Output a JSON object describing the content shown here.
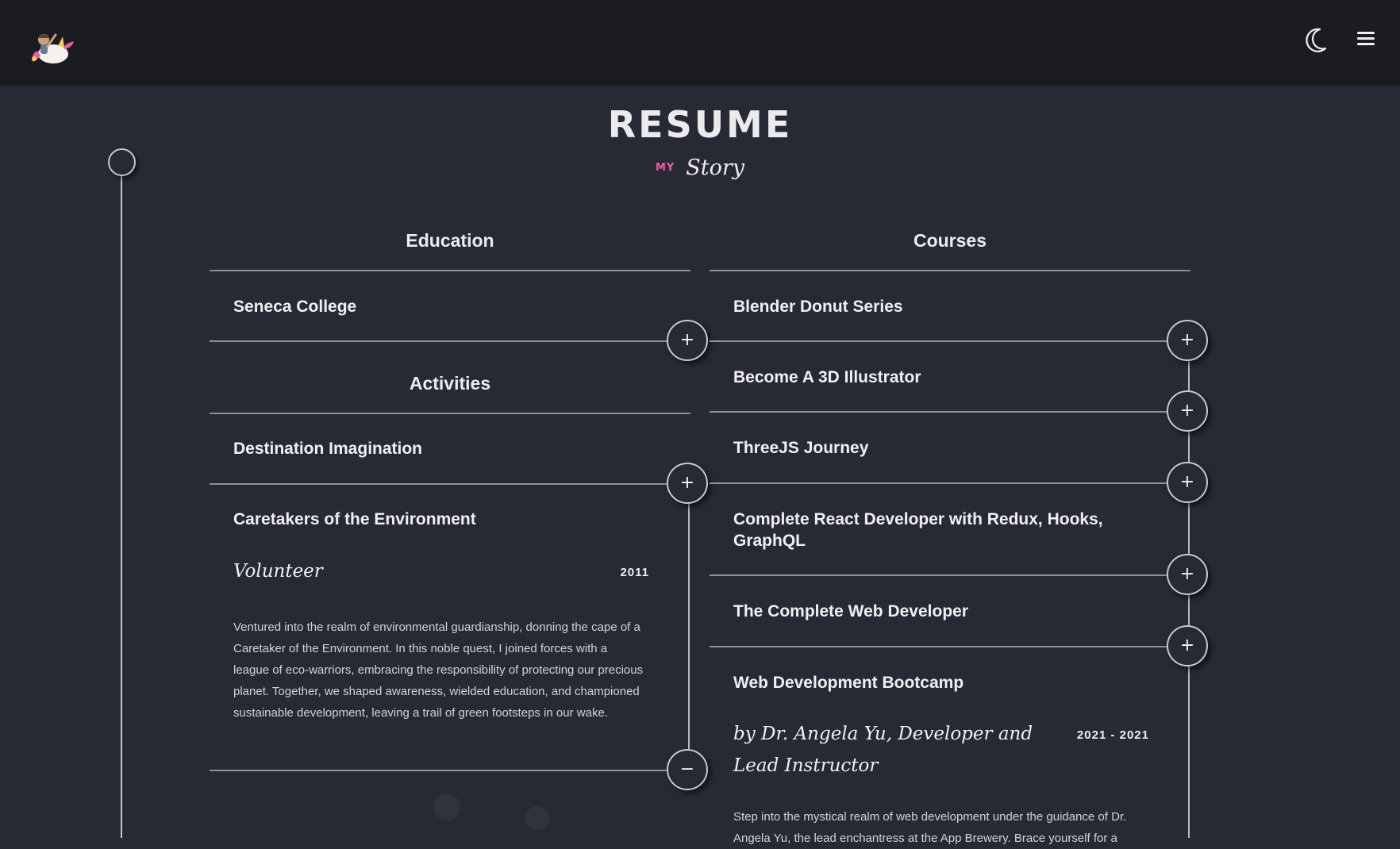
{
  "header": {
    "logo_icon": "unicorn-avatar-icon",
    "theme_icon": "moon-icon",
    "menu_icon": "hamburger-icon"
  },
  "page": {
    "title": "RESUME",
    "subtitle_small": "MY",
    "subtitle_script": "Story"
  },
  "colors": {
    "header_bg": "#1b1c22",
    "page_bg": "#272a35",
    "accent_pink": "#e85fa3"
  },
  "education": {
    "heading": "Education",
    "items": [
      {
        "title": "Seneca College",
        "toggle": "+"
      }
    ]
  },
  "activities": {
    "heading": "Activities",
    "items": [
      {
        "title": "Destination Imagination",
        "toggle": "+"
      },
      {
        "title": "Caretakers of the Environment",
        "role": "Volunteer",
        "date": "2011",
        "description": "Ventured into the realm of environmental guardianship, donning the cape of a Caretaker of the Environment. In this noble quest, I joined forces with a league of eco-warriors, embracing the responsibility of protecting our precious planet. Together, we shaped awareness, wielded education, and championed sustainable development, leaving a trail of green footsteps in our wake.",
        "toggle": "−"
      }
    ]
  },
  "courses": {
    "heading": "Courses",
    "items": [
      {
        "title": "Blender Donut Series",
        "toggle": "+"
      },
      {
        "title": "Become A 3D Illustrator",
        "toggle": "+"
      },
      {
        "title": "ThreeJS Journey",
        "toggle": "+"
      },
      {
        "title": "Complete React Developer with Redux, Hooks, GraphQL",
        "toggle": "+"
      },
      {
        "title": "The Complete Web Developer",
        "toggle": "+"
      },
      {
        "title": "Web Development Bootcamp",
        "role": "by Dr. Angela Yu, Developer and Lead Instructor",
        "date": "2021 - 2021",
        "description": "Step into the mystical realm of web development under the guidance of Dr. Angela Yu, the lead enchantress at the App Brewery. Brace yourself for a"
      }
    ]
  }
}
